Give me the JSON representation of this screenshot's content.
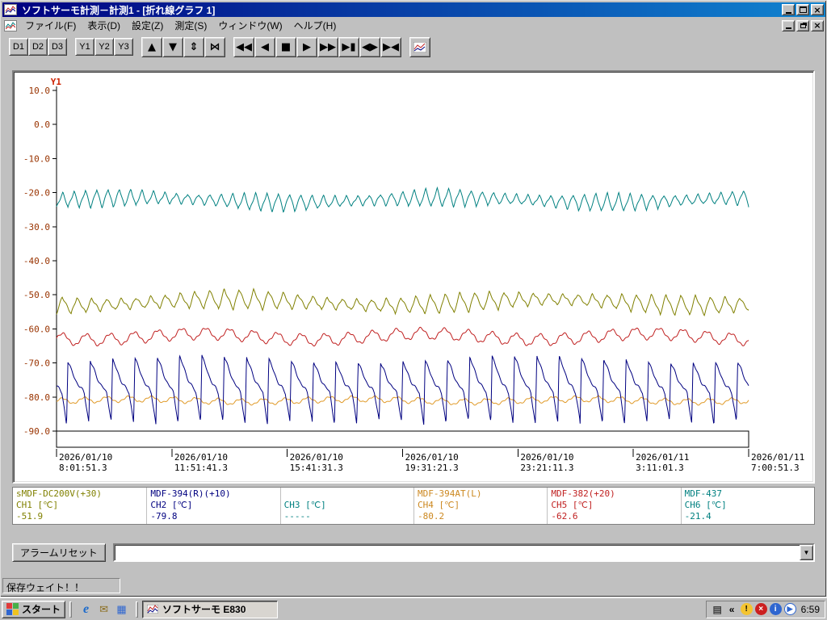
{
  "window": {
    "title": "ソフトサーモ計測－計測1 - [折れ線グラフ 1]",
    "menus": [
      {
        "id": "file",
        "label": "ファイル(F)"
      },
      {
        "id": "view",
        "label": "表示(D)"
      },
      {
        "id": "settings",
        "label": "設定(Z)"
      },
      {
        "id": "measure",
        "label": "測定(S)"
      },
      {
        "id": "window",
        "label": "ウィンドウ(W)"
      },
      {
        "id": "help",
        "label": "ヘルプ(H)"
      }
    ]
  },
  "toolbar": {
    "display_buttons": [
      "D1",
      "D2",
      "D3"
    ],
    "axis_buttons": [
      "Y1",
      "Y2",
      "Y3"
    ],
    "scale_buttons": [
      {
        "id": "scroll-up",
        "glyph": "▲"
      },
      {
        "id": "scroll-down",
        "glyph": "▼"
      },
      {
        "id": "fit-vertical",
        "glyph": "⇕"
      },
      {
        "id": "compress-vertical",
        "glyph": "⋈"
      }
    ],
    "nav_buttons": [
      {
        "id": "fast-rewind",
        "glyph": "◀◀"
      },
      {
        "id": "step-back",
        "glyph": "◀"
      },
      {
        "id": "stop",
        "glyph": "■"
      },
      {
        "id": "step-forward",
        "glyph": "▶"
      },
      {
        "id": "fast-forward",
        "glyph": "▶▶"
      },
      {
        "id": "skip-to-end",
        "glyph": "▶▮"
      },
      {
        "id": "expand-time",
        "glyph": "◀▶"
      },
      {
        "id": "collapse-time",
        "glyph": "▶◀"
      }
    ]
  },
  "chart_data": {
    "type": "line",
    "title": "折れ線グラフ 1",
    "grid": false,
    "y_axis": {
      "label": "Y1",
      "min": -90,
      "max": 10,
      "tick_interval": 10,
      "ticks": [
        "10.0",
        "0.0",
        "-10.0",
        "-20.0",
        "-30.0",
        "-40.0",
        "-50.0",
        "-60.0",
        "-70.0",
        "-80.0",
        "-90.0"
      ],
      "label_color": "#cc2200",
      "tick_color": "#993300"
    },
    "x_ticks": [
      {
        "date": "2026/01/10",
        "time": "8:01:51.3"
      },
      {
        "date": "2026/01/10",
        "time": "11:51:41.3"
      },
      {
        "date": "2026/01/10",
        "time": "15:41:31.3"
      },
      {
        "date": "2026/01/10",
        "time": "19:31:21.3"
      },
      {
        "date": "2026/01/10",
        "time": "23:21:11.3"
      },
      {
        "date": "2026/01/11",
        "time": "3:11:01.3"
      },
      {
        "date": "2026/01/11",
        "time": "7:00:51.3"
      }
    ],
    "series": [
      {
        "name": "CH6",
        "color": "#008080",
        "waveform": "saw",
        "base": -22.2,
        "amplitude": 2.1,
        "cycles": 61,
        "skew": 0.55,
        "drift": 0.7,
        "noise": 0.5
      },
      {
        "name": "CH1",
        "color": "#808000",
        "waveform": "saw",
        "base": -52.2,
        "amplitude": 2.3,
        "cycles": 47,
        "skew": 0.38,
        "drift": 0.9,
        "noise": 0.5
      },
      {
        "name": "CH5",
        "color": "#c02020",
        "waveform": "sine",
        "base": -62.3,
        "amplitude": 1.6,
        "cycles": 29,
        "drift": 0.9,
        "noise": 0.6
      },
      {
        "name": "CH4",
        "color": "#e09a28",
        "waveform": "sine",
        "base": -81.0,
        "amplitude": 0.8,
        "cycles": 31,
        "drift": 0.4,
        "noise": 0.4
      },
      {
        "name": "CH2",
        "color": "#000080",
        "waveform": "spike",
        "min": -87.5,
        "max": -68.8,
        "mid": -79.2,
        "rise": 0.06,
        "fall": 0.8,
        "cycles": 31,
        "noise": 0.5,
        "phase0": 0.55
      }
    ]
  },
  "legend": {
    "channels": [
      {
        "sensor": "sMDF-DC200V(+30)",
        "channel": "CH1 [℃]",
        "value": "-51.9",
        "color": "#808000"
      },
      {
        "sensor": "MDF-394(R)(+10)",
        "channel": "CH2 [℃]",
        "value": "-79.8",
        "color": "#000080"
      },
      {
        "sensor": "",
        "channel": "CH3 [℃]",
        "value": "-----",
        "color": "#008080"
      },
      {
        "sensor": "MDF-394AT(L)",
        "channel": "CH4 [℃]",
        "value": "-80.2",
        "color": "#cc8820"
      },
      {
        "sensor": "MDF-382(+20)",
        "channel": "CH5 [℃]",
        "value": "-62.6",
        "color": "#c02020"
      },
      {
        "sensor": "MDF-437",
        "channel": "CH6 [℃]",
        "value": "-21.4",
        "color": "#008080"
      }
    ]
  },
  "alarm": {
    "reset_label": "アラームリセット",
    "combobox_value": ""
  },
  "status": {
    "text": "保存ウェイト！！"
  },
  "taskbar": {
    "start_label": "スタート",
    "task_label": "ソフトサーモ  E830",
    "clock": "6:59",
    "quick_launch": [
      {
        "name": "internet-explorer"
      },
      {
        "name": "mail"
      },
      {
        "name": "show-desktop"
      }
    ],
    "tray_icons": [
      {
        "name": "input-method"
      },
      {
        "name": "collapse"
      },
      {
        "name": "alert"
      },
      {
        "name": "security"
      },
      {
        "name": "info"
      },
      {
        "name": "media"
      }
    ]
  }
}
